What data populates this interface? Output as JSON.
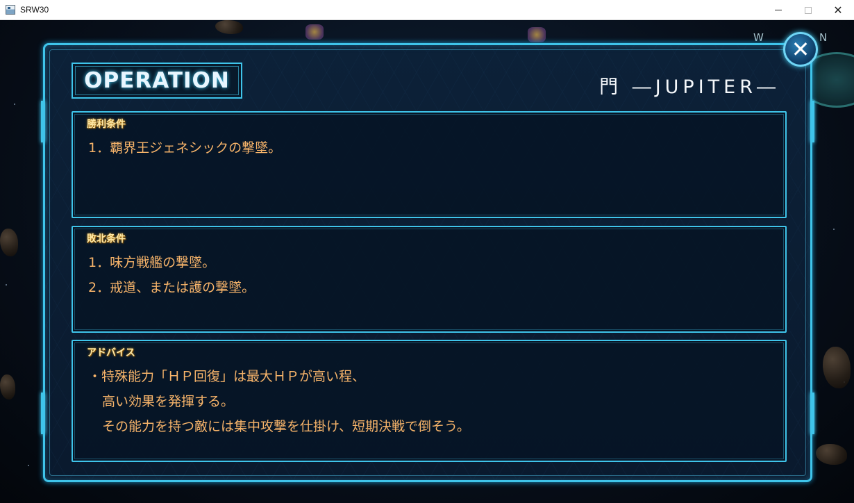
{
  "window": {
    "title": "SRW30",
    "minimize_icon": "minimize-icon",
    "maximize_icon": "maximize-icon",
    "close_glyph": "✕"
  },
  "operation": {
    "heading": "OPERATION",
    "stage_name": "門 ―JUPITER―",
    "close_glyph": "✕",
    "sections": [
      {
        "label": "勝利条件",
        "lines": [
          "1．覇界王ジェネシックの撃墜。"
        ]
      },
      {
        "label": "敗北条件",
        "lines": [
          "1．味方戦艦の撃墜。",
          "2．戒道、または護の撃墜。"
        ]
      },
      {
        "label": "アドバイス",
        "lines": [
          "・特殊能力「ＨＰ回復」は最大ＨＰが高い程、",
          "高い効果を発揮する。",
          "その能力を持つ敵には集中攻撃を仕掛け、短期決戦で倒そう。"
        ]
      }
    ]
  },
  "compass": {
    "west": "W",
    "north": "N"
  },
  "colors": {
    "frame": "#3fc4ea",
    "text_orange": "#f7b46a",
    "label_gold": "#ffe9a6"
  }
}
